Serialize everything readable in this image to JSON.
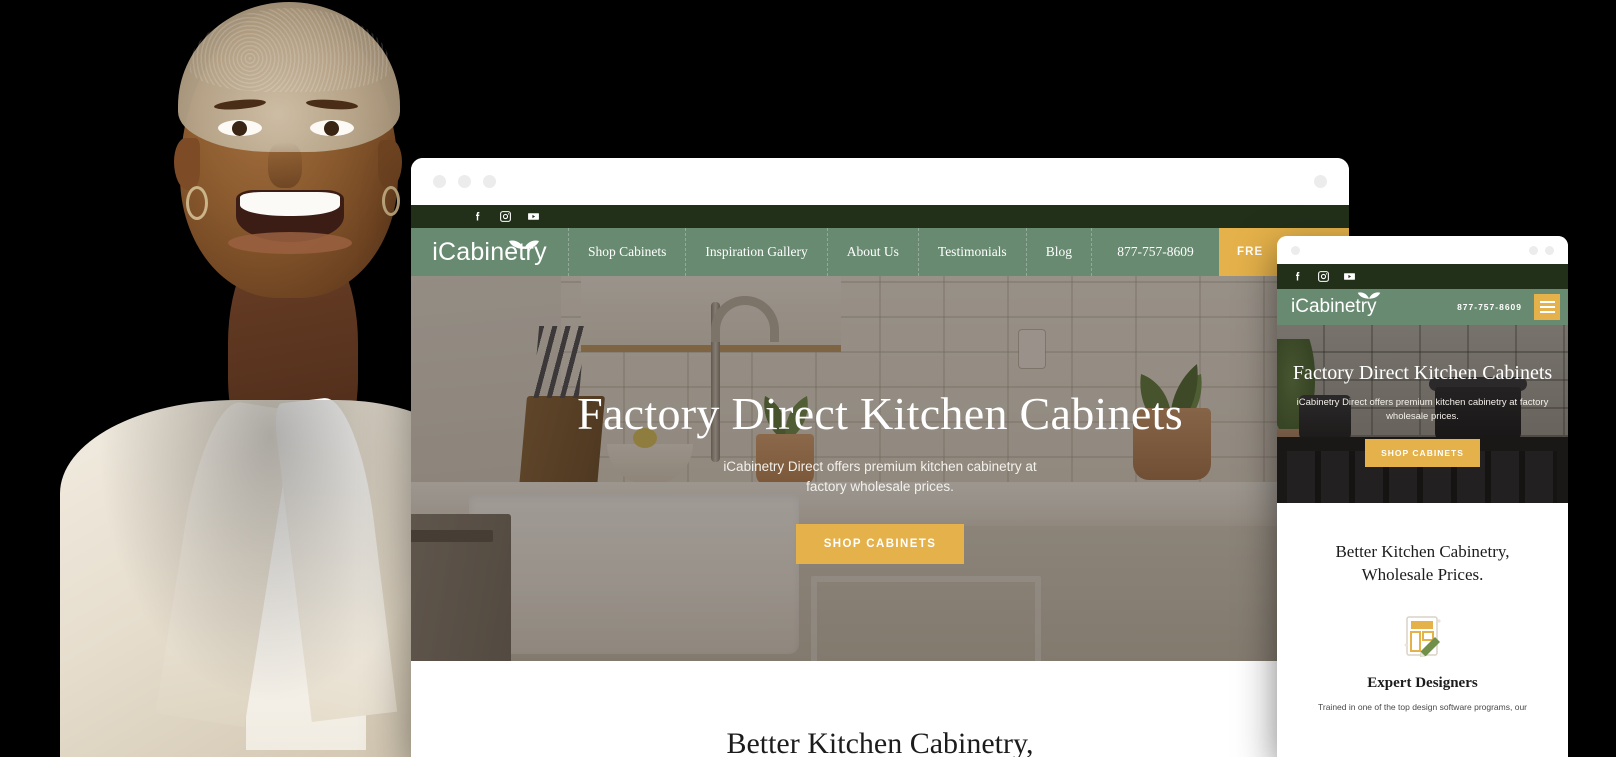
{
  "desktop": {
    "social": [
      {
        "name": "facebook-icon",
        "label": "Facebook"
      },
      {
        "name": "instagram-icon",
        "label": "Instagram"
      },
      {
        "name": "youtube-icon",
        "label": "YouTube"
      }
    ],
    "logo": "iCabinetry",
    "nav": [
      {
        "label": "Shop Cabinets"
      },
      {
        "label": "Inspiration Gallery"
      },
      {
        "label": "About Us"
      },
      {
        "label": "Testimonials"
      },
      {
        "label": "Blog"
      }
    ],
    "phone": "877-757-8609",
    "cta": "FRE",
    "hero": {
      "heading": "Factory Direct Kitchen Cabinets",
      "subheading": "iCabinetry Direct offers premium kitchen cabinetry at factory wholesale prices.",
      "button": "SHOP CABINETS"
    },
    "section_heading": "Better Kitchen Cabinetry,"
  },
  "mobile": {
    "social": [
      {
        "name": "facebook-icon",
        "label": "Facebook"
      },
      {
        "name": "instagram-icon",
        "label": "Instagram"
      },
      {
        "name": "youtube-icon",
        "label": "YouTube"
      }
    ],
    "logo": "iCabinetry",
    "phone": "877-757-8609",
    "menu_icon": "hamburger-menu-icon",
    "hero": {
      "heading": "Factory Direct Kitchen Cabinets",
      "subheading": "iCabinetry Direct offers premium kitchen cabinetry at factory wholesale prices.",
      "button": "SHOP CABINETS"
    },
    "section": {
      "heading": "Better Kitchen Cabinetry, Wholesale Prices.",
      "feature_icon": "design-blueprint-icon",
      "feature_title": "Expert Designers",
      "feature_text": "Trained in one of the top design software programs, our"
    }
  },
  "colors": {
    "dark_green": "#22301a",
    "sage_green": "#688a70",
    "gold": "#e4b14a",
    "background": "#000000",
    "white": "#ffffff"
  }
}
